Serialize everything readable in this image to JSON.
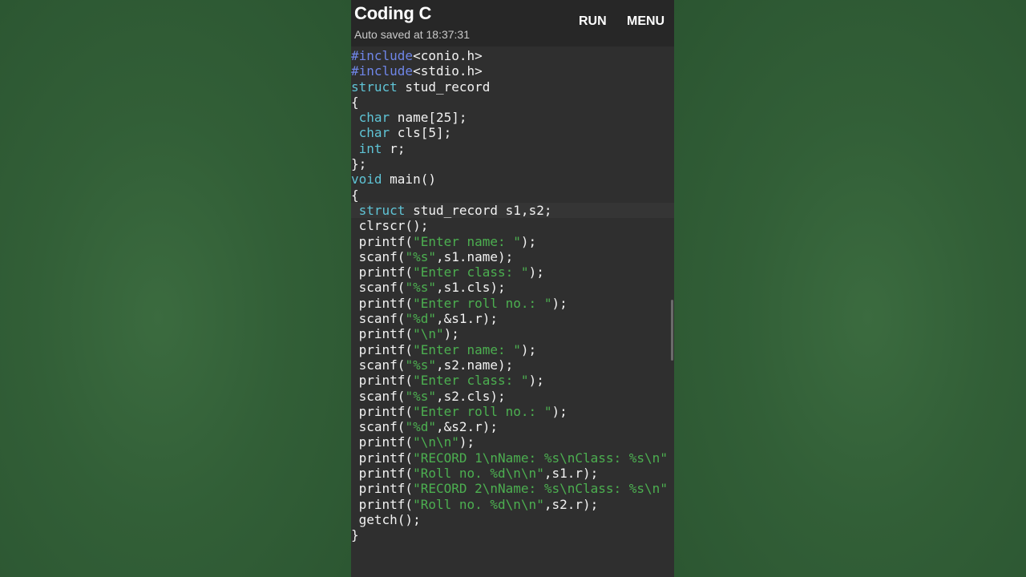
{
  "app": {
    "title": "Coding C",
    "subtitle": "Auto saved at 18:37:31",
    "actions": {
      "run": "RUN",
      "menu": "MENU"
    }
  },
  "colors": {
    "directive": "#6f86e8",
    "keyword": "#5fc4d6",
    "string": "#4caf50",
    "text": "#f2f2f2",
    "background": "#2f2f2f",
    "appbar": "#272727",
    "side_background": "#325f37"
  },
  "editor": {
    "current_line": 10,
    "lines": [
      [
        {
          "t": "#include",
          "c": "kw-dir"
        },
        {
          "t": "<conio.h>",
          "c": "plain"
        }
      ],
      [
        {
          "t": "#include",
          "c": "kw-dir"
        },
        {
          "t": "<stdio.h>",
          "c": "plain"
        }
      ],
      [
        {
          "t": "struct",
          "c": "kw"
        },
        {
          "t": " stud_record",
          "c": "plain"
        }
      ],
      [
        {
          "t": "{",
          "c": "plain"
        }
      ],
      [
        {
          "t": " ",
          "c": "plain"
        },
        {
          "t": "char",
          "c": "kw"
        },
        {
          "t": " name[25];",
          "c": "plain"
        }
      ],
      [
        {
          "t": " ",
          "c": "plain"
        },
        {
          "t": "char",
          "c": "kw"
        },
        {
          "t": " cls[5];",
          "c": "plain"
        }
      ],
      [
        {
          "t": " ",
          "c": "plain"
        },
        {
          "t": "int",
          "c": "kw"
        },
        {
          "t": " r;",
          "c": "plain"
        }
      ],
      [
        {
          "t": "};",
          "c": "plain"
        }
      ],
      [
        {
          "t": "void",
          "c": "kw"
        },
        {
          "t": " main()",
          "c": "plain"
        }
      ],
      [
        {
          "t": "{",
          "c": "plain"
        }
      ],
      [
        {
          "t": " ",
          "c": "plain"
        },
        {
          "t": "struct",
          "c": "kw"
        },
        {
          "t": " stud_record s1,s2;",
          "c": "plain"
        }
      ],
      [
        {
          "t": " clrscr();",
          "c": "plain"
        }
      ],
      [
        {
          "t": " printf(",
          "c": "plain"
        },
        {
          "t": "\"Enter name: \"",
          "c": "str"
        },
        {
          "t": ");",
          "c": "plain"
        }
      ],
      [
        {
          "t": " scanf(",
          "c": "plain"
        },
        {
          "t": "\"%s\"",
          "c": "str"
        },
        {
          "t": ",s1.name);",
          "c": "plain"
        }
      ],
      [
        {
          "t": " printf(",
          "c": "plain"
        },
        {
          "t": "\"Enter class: \"",
          "c": "str"
        },
        {
          "t": ");",
          "c": "plain"
        }
      ],
      [
        {
          "t": " scanf(",
          "c": "plain"
        },
        {
          "t": "\"%s\"",
          "c": "str"
        },
        {
          "t": ",s1.cls);",
          "c": "plain"
        }
      ],
      [
        {
          "t": " printf(",
          "c": "plain"
        },
        {
          "t": "\"Enter roll no.: \"",
          "c": "str"
        },
        {
          "t": ");",
          "c": "plain"
        }
      ],
      [
        {
          "t": " scanf(",
          "c": "plain"
        },
        {
          "t": "\"%d\"",
          "c": "str"
        },
        {
          "t": ",&s1.r);",
          "c": "plain"
        }
      ],
      [
        {
          "t": " printf(",
          "c": "plain"
        },
        {
          "t": "\"\\n\"",
          "c": "str"
        },
        {
          "t": ");",
          "c": "plain"
        }
      ],
      [
        {
          "t": " printf(",
          "c": "plain"
        },
        {
          "t": "\"Enter name: \"",
          "c": "str"
        },
        {
          "t": ");",
          "c": "plain"
        }
      ],
      [
        {
          "t": " scanf(",
          "c": "plain"
        },
        {
          "t": "\"%s\"",
          "c": "str"
        },
        {
          "t": ",s2.name);",
          "c": "plain"
        }
      ],
      [
        {
          "t": " printf(",
          "c": "plain"
        },
        {
          "t": "\"Enter class: \"",
          "c": "str"
        },
        {
          "t": ");",
          "c": "plain"
        }
      ],
      [
        {
          "t": " scanf(",
          "c": "plain"
        },
        {
          "t": "\"%s\"",
          "c": "str"
        },
        {
          "t": ",s2.cls);",
          "c": "plain"
        }
      ],
      [
        {
          "t": " printf(",
          "c": "plain"
        },
        {
          "t": "\"Enter roll no.: \"",
          "c": "str"
        },
        {
          "t": ");",
          "c": "plain"
        }
      ],
      [
        {
          "t": " scanf(",
          "c": "plain"
        },
        {
          "t": "\"%d\"",
          "c": "str"
        },
        {
          "t": ",&s2.r);",
          "c": "plain"
        }
      ],
      [
        {
          "t": " printf(",
          "c": "plain"
        },
        {
          "t": "\"\\n\\n\"",
          "c": "str"
        },
        {
          "t": ");",
          "c": "plain"
        }
      ],
      [
        {
          "t": " printf(",
          "c": "plain"
        },
        {
          "t": "\"RECORD 1\\nName: %s\\nClass: %s\\n\"",
          "c": "str"
        }
      ],
      [
        {
          "t": " printf(",
          "c": "plain"
        },
        {
          "t": "\"Roll no. %d\\n\\n\"",
          "c": "str"
        },
        {
          "t": ",s1.r);",
          "c": "plain"
        }
      ],
      [
        {
          "t": " printf(",
          "c": "plain"
        },
        {
          "t": "\"RECORD 2\\nName: %s\\nClass: %s\\n\"",
          "c": "str"
        }
      ],
      [
        {
          "t": " printf(",
          "c": "plain"
        },
        {
          "t": "\"Roll no. %d\\n\\n\"",
          "c": "str"
        },
        {
          "t": ",s2.r);",
          "c": "plain"
        }
      ],
      [
        {
          "t": " getch();",
          "c": "plain"
        }
      ],
      [
        {
          "t": "}",
          "c": "plain"
        }
      ]
    ]
  }
}
